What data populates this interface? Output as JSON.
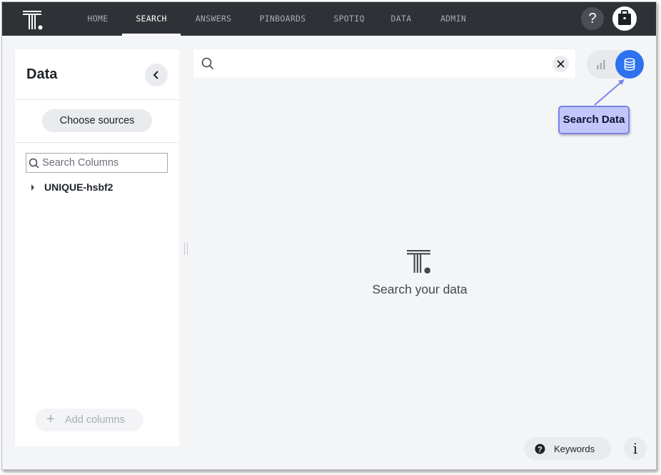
{
  "nav": {
    "items": [
      {
        "label": "HOME"
      },
      {
        "label": "SEARCH"
      },
      {
        "label": "ANSWERS"
      },
      {
        "label": "PINBOARDS"
      },
      {
        "label": "SPOTIQ"
      },
      {
        "label": "DATA"
      },
      {
        "label": "ADMIN"
      }
    ],
    "active": "SEARCH",
    "help_label": "?"
  },
  "data_panel": {
    "title": "Data",
    "choose_sources_label": "Choose sources",
    "search_columns_placeholder": "Search Columns",
    "sources": [
      {
        "name": "UNIQUE-hsbf2"
      }
    ],
    "add_columns_label": "Add columns"
  },
  "search": {
    "query": "",
    "placeholder": ""
  },
  "callout": {
    "label": "Search Data"
  },
  "empty_state": {
    "message": "Search your data"
  },
  "footer": {
    "keywords_label": "Keywords",
    "info_label": "i"
  },
  "colors": {
    "nav_bg": "#2e3136",
    "accent": "#2f72f0",
    "callout_bg": "#c2c7fb",
    "callout_border": "#7b82ec"
  }
}
